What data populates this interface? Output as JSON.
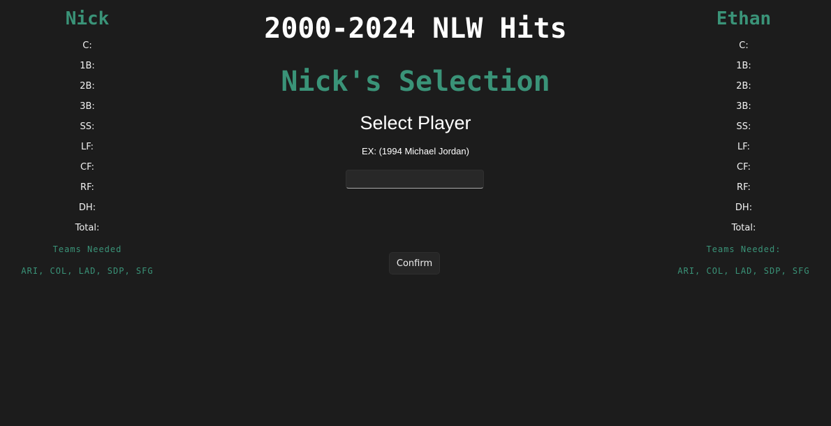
{
  "title": "2000-2024 NLW Hits",
  "selection_heading": "Nick's Selection",
  "select_player": "Select Player",
  "example": "EX: (1994 Michael Jordan)",
  "input_value": "",
  "confirm_label": "Confirm",
  "left": {
    "name": "Nick",
    "positions": [
      "C:",
      "1B:",
      "2B:",
      "3B:",
      "SS:",
      "LF:",
      "CF:",
      "RF:",
      "DH:",
      "Total:"
    ],
    "teams_label": "Teams Needed",
    "teams": "ARI, COL, LAD, SDP, SFG"
  },
  "right": {
    "name": "Ethan",
    "positions": [
      "C:",
      "1B:",
      "2B:",
      "3B:",
      "SS:",
      "LF:",
      "CF:",
      "RF:",
      "DH:",
      "Total:"
    ],
    "teams_label": "Teams Needed:",
    "teams": "ARI, COL, LAD, SDP, SFG"
  },
  "colors": {
    "accent": "#3a9378",
    "background": "#1c1c1c"
  }
}
